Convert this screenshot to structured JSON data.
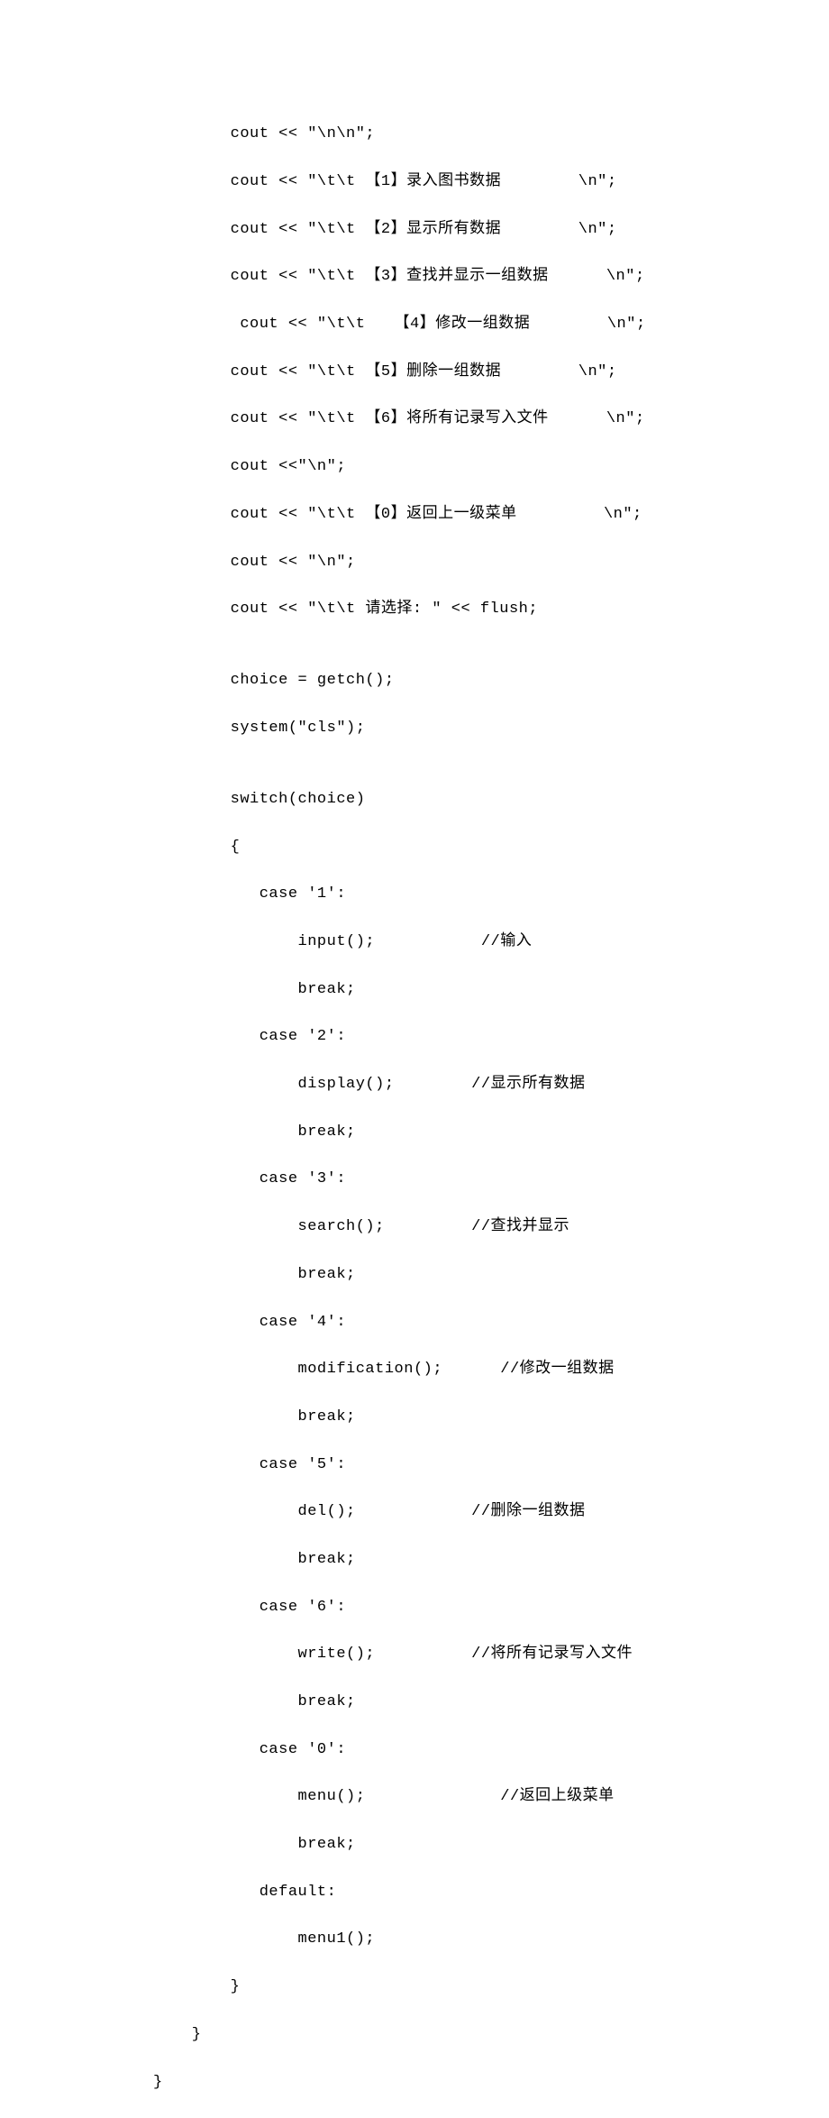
{
  "code": {
    "l01": "        cout << \"\\n\\n\";",
    "l02": "        cout << \"\\t\\t 【1】录入图书数据        \\n\";",
    "l03": "        cout << \"\\t\\t 【2】显示所有数据        \\n\";",
    "l04": "        cout << \"\\t\\t 【3】查找并显示一组数据      \\n\";",
    "l05": "         cout << \"\\t\\t   【4】修改一组数据        \\n\";",
    "l06": "        cout << \"\\t\\t 【5】删除一组数据        \\n\";",
    "l07": "        cout << \"\\t\\t 【6】将所有记录写入文件      \\n\";",
    "l08": "        cout <<\"\\n\";",
    "l09": "        cout << \"\\t\\t 【0】返回上一级菜单         \\n\";",
    "l10": "        cout << \"\\n\";",
    "l11": "        cout << \"\\t\\t 请选择: \" << flush;",
    "l12": "",
    "l13": "        choice = getch();",
    "l14": "        system(\"cls\");",
    "l15": "",
    "l16": "        switch(choice)",
    "l17": "        {",
    "l18": "           case '1':",
    "l19": "               input();           //输入",
    "l20": "               break;",
    "l21": "           case '2':",
    "l22": "               display();        //显示所有数据",
    "l23": "               break;",
    "l24": "           case '3':",
    "l25": "               search();         //查找并显示",
    "l26": "               break;",
    "l27": "           case '4':",
    "l28": "               modification();      //修改一组数据",
    "l29": "               break;",
    "l30": "           case '5':",
    "l31": "               del();            //删除一组数据",
    "l32": "               break;",
    "l33": "           case '6':",
    "l34": "               write();          //将所有记录写入文件",
    "l35": "               break;",
    "l36": "           case '0':",
    "l37": "               menu();              //返回上级菜单",
    "l38": "               break;",
    "l39": "           default:",
    "l40": "               menu1();",
    "l41": "        }",
    "l42": "    }",
    "l43": "}"
  }
}
